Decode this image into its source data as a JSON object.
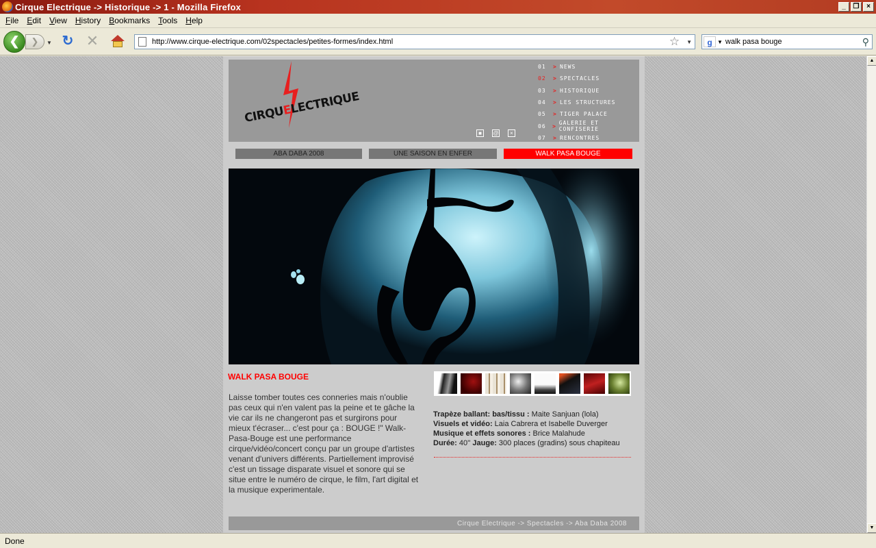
{
  "window": {
    "title": "Cirque Electrique -> Historique -> 1 - Mozilla Firefox",
    "controls": [
      "_",
      "❐",
      "×"
    ]
  },
  "menu": [
    "File",
    "Edit",
    "View",
    "History",
    "Bookmarks",
    "Tools",
    "Help"
  ],
  "toolbar": {
    "url": "http://www.cirque-electrique.com/02spectacles/petites-formes/index.html",
    "search_value": "walk pasa bouge",
    "search_engine_icon": "google-icon"
  },
  "site": {
    "logo_text_before": "CIRQU",
    "logo_text_e": "E",
    "logo_text_after": "LECTRIQUE",
    "nav": [
      {
        "num": "01",
        "label": "NEWS"
      },
      {
        "num": "02",
        "label": "SPECTACLES"
      },
      {
        "num": "03",
        "label": "HISTORIQUE"
      },
      {
        "num": "04",
        "label": "LES STRUCTURES"
      },
      {
        "num": "05",
        "label": "TIGER PALACE"
      },
      {
        "num": "06",
        "label": "GALERIE ET CONFISERIE"
      },
      {
        "num": "07",
        "label": "RENCONTRES"
      }
    ],
    "nav_arrow": ">",
    "active_nav_index": 1,
    "tabs": [
      "ABA DABA 2008",
      "UNE SAISON EN ENFER",
      "WALK PASA BOUGE"
    ],
    "show_title": "WALK PASA BOUGE",
    "description": "Laisse tomber toutes ces conneries mais n'oublie pas ceux qui n'en valent pas la peine et te gâche la vie car ils ne changeront pas et surgirons pour mieux t'écraser... c'est pour ça : BOUGE !\" Walk-Pasa-Bouge est une performance cirque/vidéo/concert conçu par un groupe d'artistes venant d'univers différents. Partiellement improvisé c'est un tissage disparate visuel et sonore qui se situe entre le numéro de cirque, le film, l'art digital et la musique experimentale.",
    "credits": [
      {
        "label": "Trapèze ballant: bas/tissu :",
        "value": " Maite Sanjuan (lola)"
      },
      {
        "label": "Visuels et vidéo:",
        "value": " Laia Cabrera et Isabelle Duverger"
      },
      {
        "label": "Musique et effets sonores :",
        "value": " Brice Malahude"
      },
      {
        "label": "Durée:",
        "value": " 40'' ",
        "label2": "Jauge:",
        "value2": " 300 places (gradins) sous chapiteau"
      }
    ],
    "footer": "Cirque Electrique -> Spectacles -> Aba Daba 2008",
    "accent_color": "#ff0000"
  },
  "status": "Done"
}
